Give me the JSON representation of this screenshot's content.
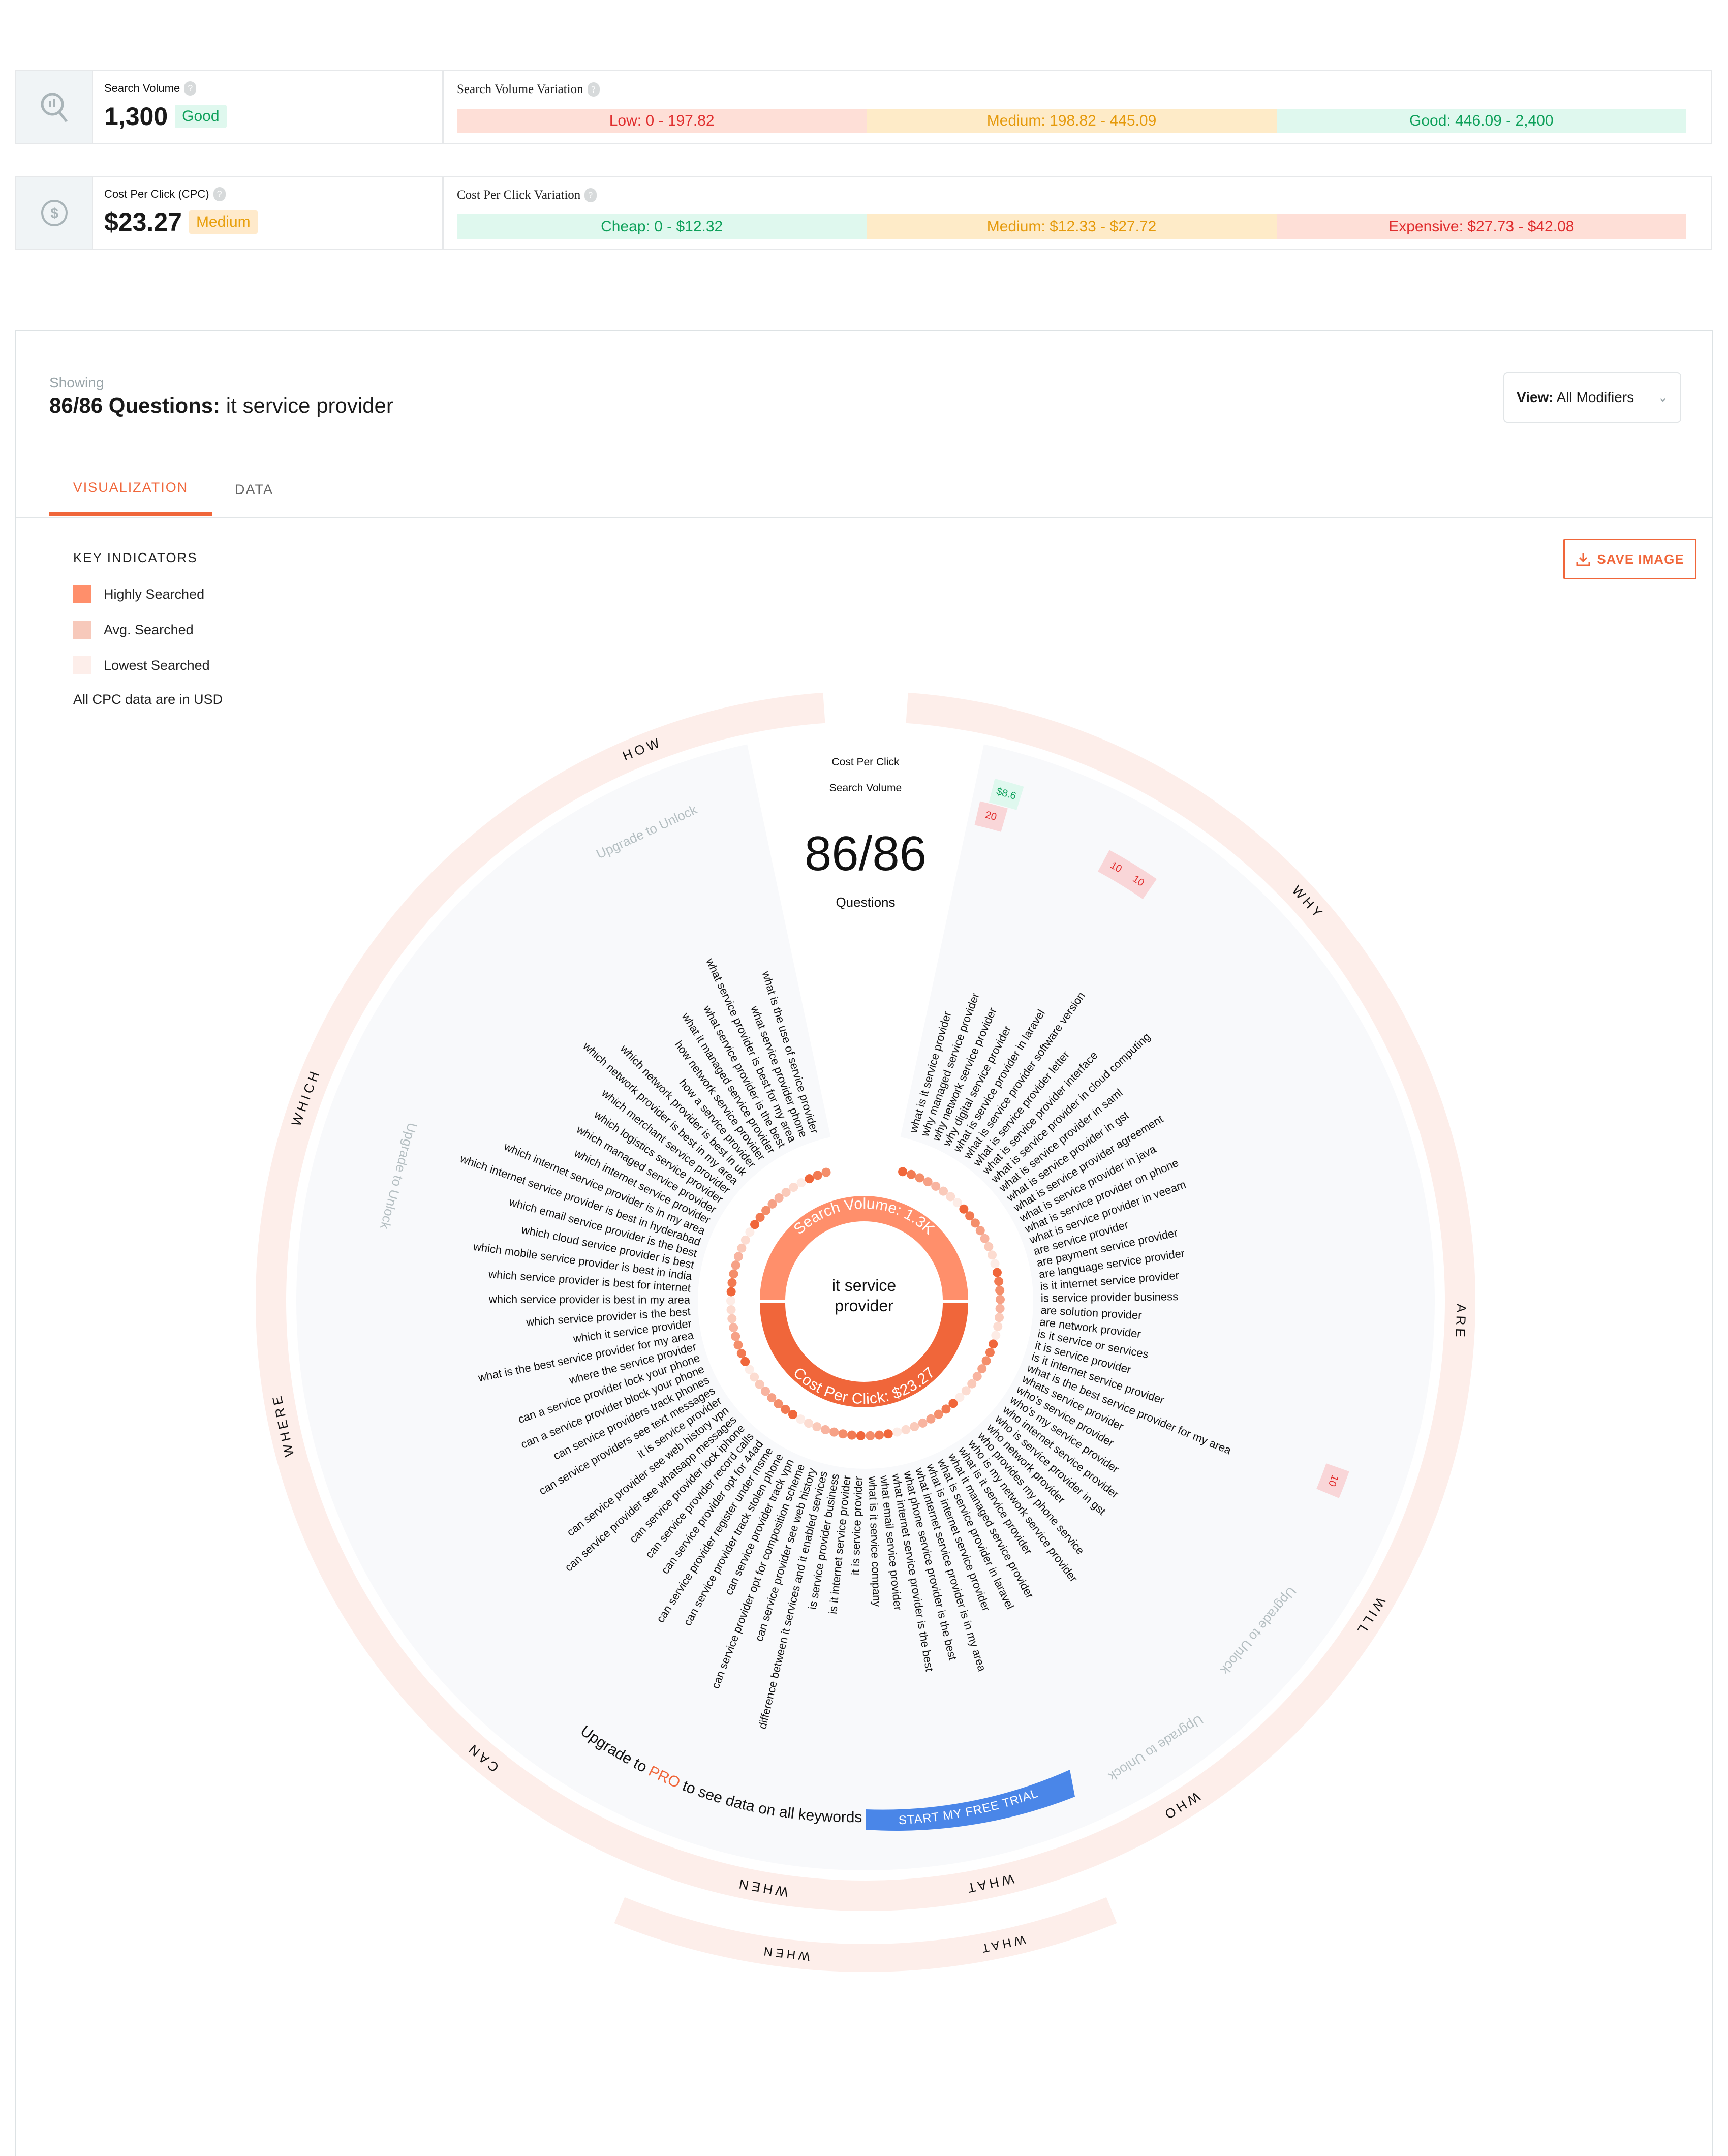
{
  "search_volume": {
    "label": "Search Volume",
    "value": "1,300",
    "badge": "Good",
    "variation_label": "Search Volume Variation",
    "ranges": [
      {
        "label": "Low: 0 - 197.82",
        "level": "red"
      },
      {
        "label": "Medium: 198.82 - 445.09",
        "level": "orange"
      },
      {
        "label": "Good: 446.09 - 2,400",
        "level": "green"
      }
    ]
  },
  "cpc": {
    "label": "Cost Per Click (CPC)",
    "value": "$23.27",
    "badge": "Medium",
    "variation_label": "Cost Per Click Variation",
    "ranges": [
      {
        "label": "Cheap: 0 - $12.32",
        "level": "green"
      },
      {
        "label": "Medium: $12.33 - $27.72",
        "level": "orange"
      },
      {
        "label": "Expensive: $27.73 - $42.08",
        "level": "red"
      }
    ]
  },
  "header": {
    "showing": "Showing",
    "title_bold": "86/86 Questions:",
    "title_rest": " it service provider",
    "view_prefix": "View:",
    "view_value": "All Modifiers"
  },
  "tabs": [
    {
      "label": "VISUALIZATION",
      "active": true
    },
    {
      "label": "DATA",
      "active": false
    }
  ],
  "save_image_label": "SAVE IMAGE",
  "legend": {
    "title": "KEY INDICATORS",
    "items": [
      {
        "label": "Highly Searched",
        "color": "#ff8f6b"
      },
      {
        "label": "Avg. Searched",
        "color": "#f7c9bb"
      },
      {
        "label": "Lowest Searched",
        "color": "#fdeeea"
      }
    ],
    "note": "All CPC data are in USD"
  },
  "wheel": {
    "center_count": "86/86",
    "center_sub": "Questions",
    "metric_label_cpc": "Cost Per Click",
    "metric_label_sv": "Search Volume",
    "keyword": "it service provider",
    "keyword_lines": [
      "it service",
      "provider"
    ],
    "sv_ring_label": "Search Volume: 1.3K",
    "cpc_ring_label": "Cost Per Click: $23.27",
    "upgrade_unlock": "Upgrade to Unlock",
    "upgrade_banner_pre": "Upgrade to ",
    "upgrade_banner_pro": "PRO",
    "upgrade_banner_post": " to see data on all keywords",
    "trial_button": "START MY FREE TRIAL",
    "colors": {
      "accent": "#f0663a",
      "sv_ring": "#ff8f6b",
      "cpc_ring": "#f0663a",
      "ring_bg": "#fdeeea",
      "trial": "#4a86e8"
    },
    "data_cells": [
      {
        "question": "what is it service provider",
        "cpc": "$8.6",
        "volume": "20"
      },
      {
        "question": "what is service provider in laravel",
        "volume": "10"
      },
      {
        "question": "what is service provider software version",
        "volume": "10"
      },
      {
        "question": "is it service or services",
        "volume": "10"
      }
    ],
    "modifiers": [
      "HOW",
      "WHY",
      "ARE",
      "WILL",
      "WHO",
      "WHAT",
      "WHEN",
      "CAN",
      "WHERE",
      "WHICH"
    ],
    "lower_modifiers": [
      "WHEN",
      "WHAT"
    ],
    "questions_right": [
      "what is it service provider",
      "why managed service provider",
      "why network service provider",
      "why digital service provider",
      "what is service provider in laravel",
      "what is service provider software version",
      "what is service provider letter",
      "what is service provider interface",
      "what is service provider in cloud computing",
      "what is service provider in saml",
      "what is service provider in gst",
      "what is service provider agreement",
      "what is service provider in java",
      "what is service provider on phone",
      "what is service provider in veeam",
      "are service provider",
      "are payment service provider",
      "are language service provider",
      "is it internet service provider",
      "is service provider business",
      "are solution provider",
      "are network provider",
      "is it service or services",
      "it is service provider",
      "is it internet service provider",
      "what is the best service provider for my area",
      "whats service provider",
      "who's service provider",
      "who's my service provider",
      "who internet service provider",
      "who is service provider in gst",
      "who network provider",
      "who provides my phone service",
      "who is my network service provider",
      "what is it service provider",
      "what it managed service provider",
      "what is service provider in laravel",
      "what is internet service provider",
      "what internet service provider is in my area",
      "what phone service provider is the best",
      "what internet service provider is the best",
      "what email service provider",
      "what is it service company"
    ],
    "questions_left": [
      "it is service provider",
      "is it internet service provider",
      "is service provider business",
      "difference between it services and it enabled services",
      "can service provider see web history",
      "can service provider opt for composition scheme",
      "can service provider track vpn",
      "can service provider track stolen phone",
      "can service provider register under msme",
      "can service provider opt for 44ad",
      "can service provider record calls",
      "can service provider lock iphone",
      "can service provider see whatsapp messages",
      "can service provider see web history vpn",
      "it is service provider",
      "can service providers see text messages",
      "can service providers track phones",
      "can a service provider block your phone",
      "can a service provider lock your phone",
      "where the service provider",
      "what is the best service provider for my area",
      "which it service provider",
      "which service provider is the best",
      "which service provider is best in my area",
      "which service provider is best for internet",
      "which mobile service provider is best in india",
      "which cloud service provider is best",
      "which email service provider is the best",
      "which internet service provider is best in hyderabad",
      "which internet service provider is in my area",
      "which internet service provider",
      "which managed service provider",
      "which logistics service provider",
      "which merchant service provider",
      "which network provider is best in my area",
      "which network provider is best in uk",
      "how a service provider",
      "how network service provider",
      "what it managed service provider",
      "what service provider is the best",
      "what service provider is best for my area",
      "what service provider phone",
      "what is the use of service provider"
    ]
  }
}
